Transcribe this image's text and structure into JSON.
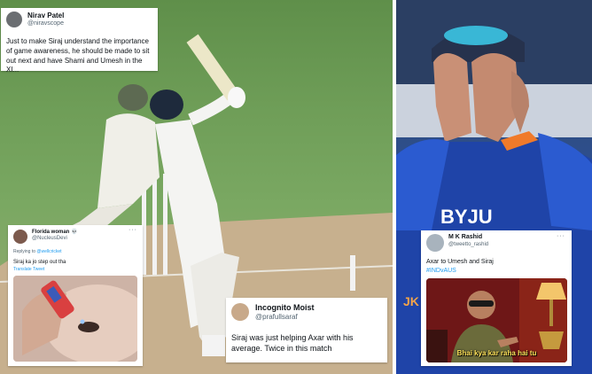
{
  "tweets": {
    "nirav": {
      "name": "Nirav Patel",
      "handle": "@niravscope",
      "text": "Just to make Siraj understand the importance of game awareness, he should be made to sit out next and have Shami and Umesh in the XI..."
    },
    "florida": {
      "name": "Florida woman 💀",
      "handle": "@NucleusDevi",
      "reply_prefix": "Replying to ",
      "reply_to": "@wellcricket",
      "text": "Siraj ka jo step out tha",
      "translate": "Translate Tweet",
      "more": "···"
    },
    "moist": {
      "name": "Incognito Moist",
      "handle": "@prafullsaraf",
      "text": "Siraj was just helping Axar with his average. Twice in this match"
    },
    "rashid": {
      "name": "M K Rashid",
      "handle": "@tweetto_rashid",
      "text_line1": "Axar to Umesh and Siraj",
      "hashtag": "#INDvAUS",
      "more": "···",
      "meme_caption": "Bhai kya kar raha hai tu"
    }
  },
  "photo": {
    "jersey_text": "BYJU",
    "jersey_side": "JK"
  }
}
